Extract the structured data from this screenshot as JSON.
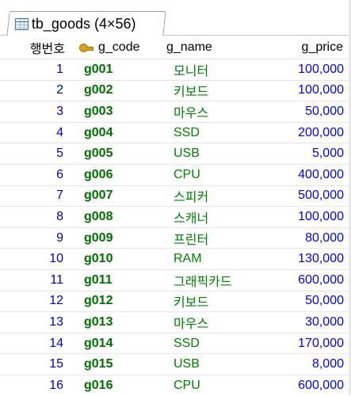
{
  "tab": {
    "label": "tb_goods (4×56)",
    "icon": "table-icon"
  },
  "columns": {
    "num": "행번호",
    "code": "g_code",
    "name": "g_name",
    "price": "g_price",
    "key_icon": "key-icon"
  },
  "rows": [
    {
      "num": "1",
      "code": "g001",
      "name": "모니터",
      "price": "100,000"
    },
    {
      "num": "2",
      "code": "g002",
      "name": "키보드",
      "price": "100,000"
    },
    {
      "num": "3",
      "code": "g003",
      "name": "마우스",
      "price": "50,000"
    },
    {
      "num": "4",
      "code": "g004",
      "name": "SSD",
      "price": "200,000"
    },
    {
      "num": "5",
      "code": "g005",
      "name": "USB",
      "price": "5,000"
    },
    {
      "num": "6",
      "code": "g006",
      "name": "CPU",
      "price": "400,000"
    },
    {
      "num": "7",
      "code": "g007",
      "name": "스피커",
      "price": "500,000"
    },
    {
      "num": "8",
      "code": "g008",
      "name": "스캐너",
      "price": "100,000"
    },
    {
      "num": "9",
      "code": "g009",
      "name": "프린터",
      "price": "80,000"
    },
    {
      "num": "10",
      "code": "g010",
      "name": "RAM",
      "price": "130,000"
    },
    {
      "num": "11",
      "code": "g011",
      "name": "그래픽카드",
      "price": "600,000"
    },
    {
      "num": "12",
      "code": "g012",
      "name": "키보드",
      "price": "50,000"
    },
    {
      "num": "13",
      "code": "g013",
      "name": "마우스",
      "price": "30,000"
    },
    {
      "num": "14",
      "code": "g014",
      "name": "SSD",
      "price": "170,000"
    },
    {
      "num": "15",
      "code": "g015",
      "name": "USB",
      "price": "8,000"
    },
    {
      "num": "16",
      "code": "g016",
      "name": "CPU",
      "price": "600,000"
    }
  ],
  "colors": {
    "row_number": "#0000cc",
    "code": "#007000",
    "name": "#008000",
    "price": "#0000ff"
  }
}
